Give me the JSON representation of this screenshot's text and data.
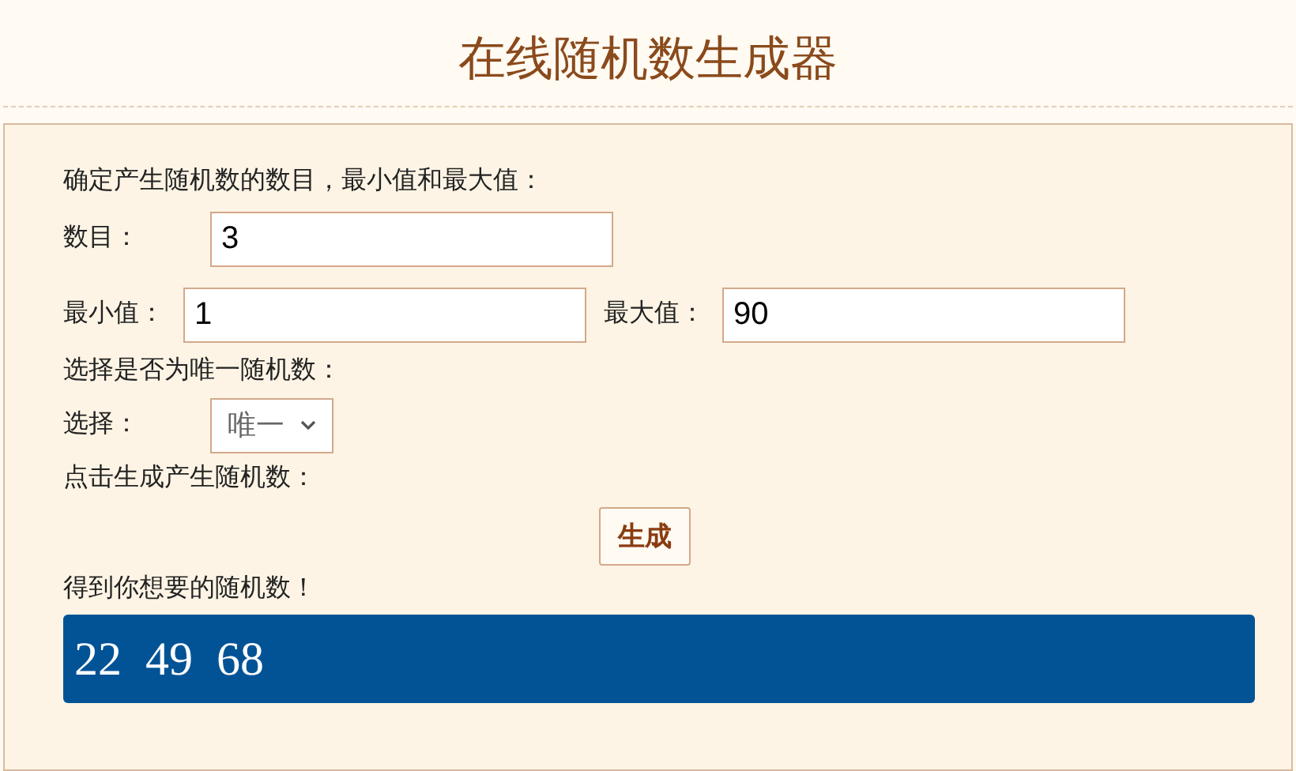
{
  "title": "在线随机数生成器",
  "intro": "确定产生随机数的数目，最小值和最大值：",
  "count": {
    "label": "数目：",
    "value": "3"
  },
  "min": {
    "label": "最小值：",
    "value": "1"
  },
  "max": {
    "label": "最大值：",
    "value": "90"
  },
  "unique_prompt": "选择是否为唯一随机数：",
  "choice": {
    "label": "选择：",
    "value": "唯一"
  },
  "generate_prompt": "点击生成产生随机数：",
  "generate_button": "生成",
  "result_label": "得到你想要的随机数！",
  "result": "22  49  68"
}
